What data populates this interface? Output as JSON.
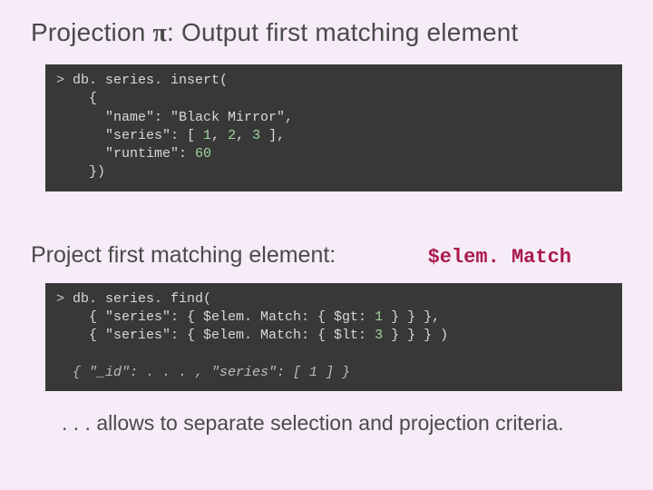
{
  "title": {
    "prefix": "Projection ",
    "pi": "π",
    "suffix": ": Output first matching element"
  },
  "code1": {
    "l1a": "> ",
    "l1b": "db. series. insert(",
    "l2": "    {",
    "l3a": "      \"name\": \"Black Mirror\"",
    "l3b": ",",
    "l4a": "      \"series\": [ ",
    "l4n1": "1",
    "l4c1": ", ",
    "l4n2": "2",
    "l4c2": ", ",
    "l4n3": "3",
    "l4b": " ],",
    "l5a": "      \"runtime\": ",
    "l5n": "60",
    "l6": "    })"
  },
  "subhead": "Project first matching element:",
  "elem_match": "$elem. Match",
  "code2": {
    "l1a": "> ",
    "l1b": "db. series. find(",
    "l2a": "    { \"series\": { $elem. Match: { $gt: ",
    "l2n": "1",
    "l2b": " } } },",
    "l3a": "    { \"series\": { $elem. Match: { $lt: ",
    "l3n": "3",
    "l3b": " } } } )",
    "blank": " ",
    "res": "  { \"_id\": . . . , \"series\": [ 1 ] }"
  },
  "footer": ". . . allows to separate selection and projection criteria."
}
